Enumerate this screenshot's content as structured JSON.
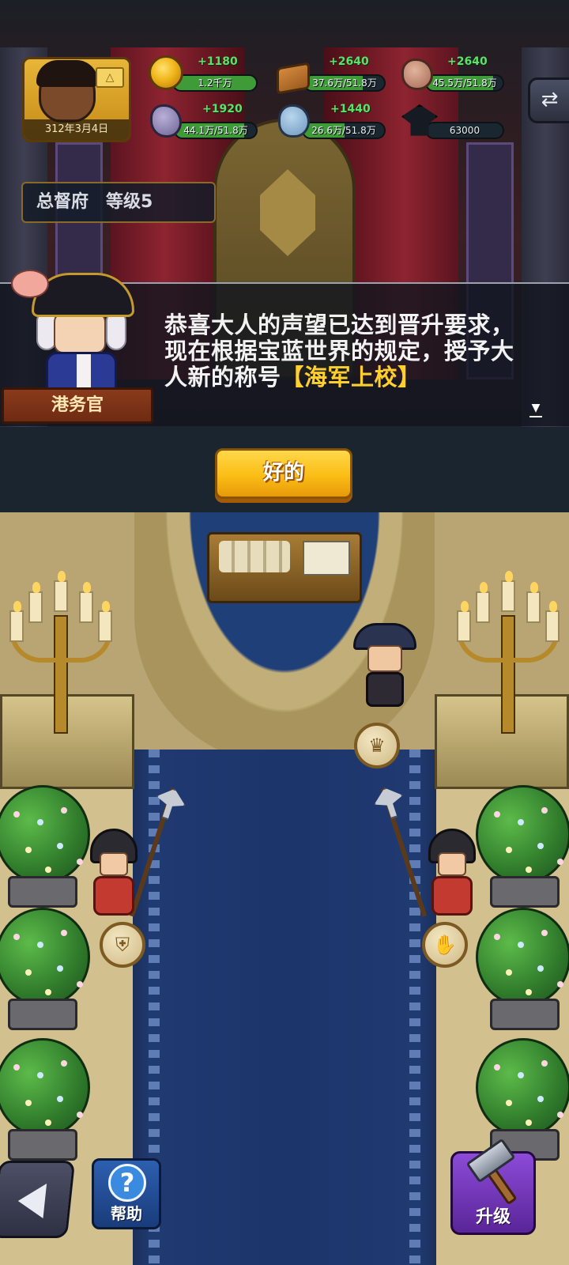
{
  "header": {
    "date": "312年3月4日",
    "rank_icon": "triangle-rank-icon",
    "resources": [
      {
        "id": "gold",
        "icon": "gold-coin-icon",
        "gain": "+1180",
        "value": "1.2千万",
        "fill": 1.0
      },
      {
        "id": "wood",
        "icon": "wood-plank-icon",
        "gain": "+2640",
        "value": "37.6万/51.8万",
        "fill": 0.726
      },
      {
        "id": "clay",
        "icon": "clay-ore-icon",
        "gain": "+2640",
        "value": "45.5万/51.8万",
        "fill": 0.878
      },
      {
        "id": "iron",
        "icon": "iron-ore-icon",
        "gain": "+1920",
        "value": "44.1万/51.8万",
        "fill": 0.851
      },
      {
        "id": "crystal",
        "icon": "crystal-ore-icon",
        "gain": "+1440",
        "value": "26.6万/51.8万",
        "fill": 0.514
      },
      {
        "id": "research",
        "icon": "graduation-cap-icon",
        "value": "63000"
      }
    ],
    "swap_icon": "⇄"
  },
  "building": {
    "name": "总督府",
    "level": "等级5"
  },
  "dialog": {
    "speaker": "港务官",
    "text_main": "恭喜大人的声望已达到晋升要求，现在根据宝蓝世界的规定，授予大人新的称号",
    "text_title": "【海军上校】",
    "next_icon": "▼"
  },
  "ok_button": {
    "label": "好的"
  },
  "map": {
    "badges": [
      {
        "icon": "crown-icon",
        "glyph": "♛"
      },
      {
        "icon": "shield-icon",
        "glyph": "⛨"
      },
      {
        "icon": "glove-icon",
        "glyph": "✋"
      }
    ]
  },
  "bottom": {
    "help_label": "帮助",
    "help_glyph": "?",
    "upgrade_label": "升级"
  },
  "colors": {
    "gain_text": "#5ee06a",
    "highlight_title": "#ffcf2e",
    "ok_button": "#fbbd15",
    "upgrade_button": "#8c4bd8",
    "help_button": "#2d5fb0"
  }
}
